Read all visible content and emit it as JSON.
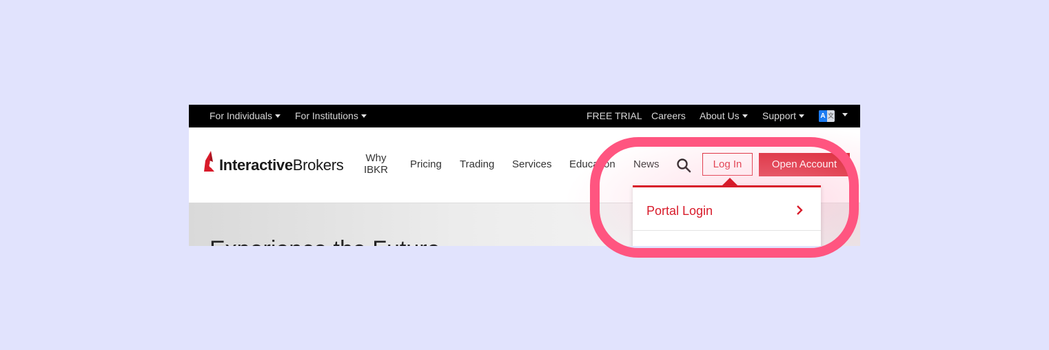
{
  "topbar": {
    "left": [
      {
        "label": "For Individuals",
        "dropdown": true
      },
      {
        "label": "For Institutions",
        "dropdown": true
      }
    ],
    "right": [
      {
        "label": "FREE TRIAL",
        "dropdown": false
      },
      {
        "label": "Careers",
        "dropdown": false
      },
      {
        "label": "About Us",
        "dropdown": true
      },
      {
        "label": "Support",
        "dropdown": true
      }
    ],
    "language_icon": {
      "icon": "translate-icon",
      "glyph_a": "A",
      "glyph_b": "文"
    }
  },
  "brand": {
    "bold": "Interactive",
    "regular": "Brokers",
    "accent": "#d81b2a"
  },
  "nav": {
    "why_line1": "Why",
    "why_line2": "IBKR",
    "items": [
      "Pricing",
      "Trading",
      "Services",
      "Education",
      "News"
    ],
    "search_icon": "search-icon",
    "login_label": "Log In",
    "open_account_label": "Open Account"
  },
  "login_menu": {
    "items": [
      {
        "label": "Portal Login",
        "icon": "chevron-right-icon"
      }
    ]
  },
  "hero": {
    "title": "Experience the Future"
  },
  "colors": {
    "accent": "#d81b2a",
    "highlight": "#ff5580",
    "background": "#e1e3fd"
  }
}
